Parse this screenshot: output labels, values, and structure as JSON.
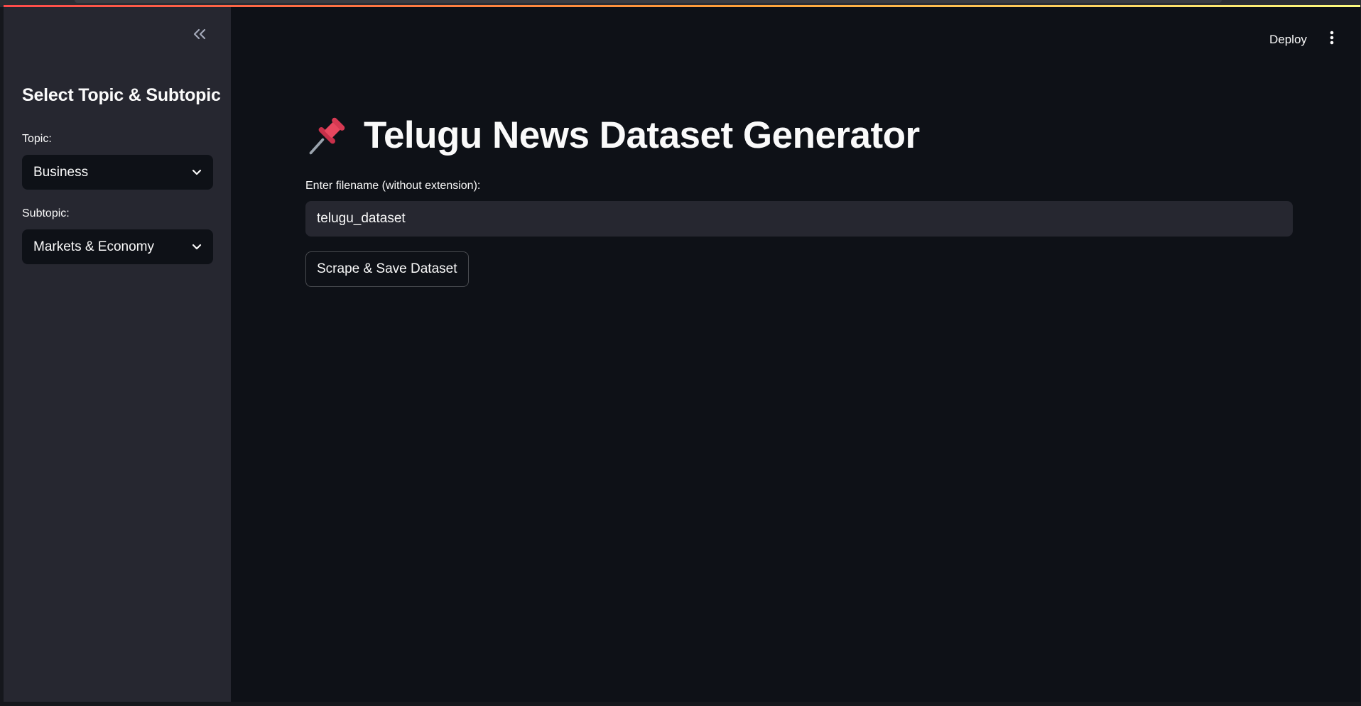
{
  "sidebar": {
    "heading": "Select Topic & Subtopic",
    "topic": {
      "label": "Topic:",
      "selected": "Business"
    },
    "subtopic": {
      "label": "Subtopic:",
      "selected": "Markets & Economy"
    },
    "collapse_icon": "double-chevron-left-icon"
  },
  "header": {
    "deploy_label": "Deploy",
    "menu_icon": "vertical-ellipsis-icon"
  },
  "main": {
    "title_icon": "pushpin-icon",
    "title": "Telugu News Dataset Generator",
    "filename_label": "Enter filename (without extension):",
    "filename_value": "telugu_dataset",
    "action_button": "Scrape & Save Dataset"
  },
  "colors": {
    "background": "#0e1117",
    "sidebar": "#262730",
    "input": "#262730",
    "text": "#fafafa",
    "accent_gradient": [
      "#ff4b4b",
      "#ffa23a",
      "#fffd80"
    ]
  }
}
